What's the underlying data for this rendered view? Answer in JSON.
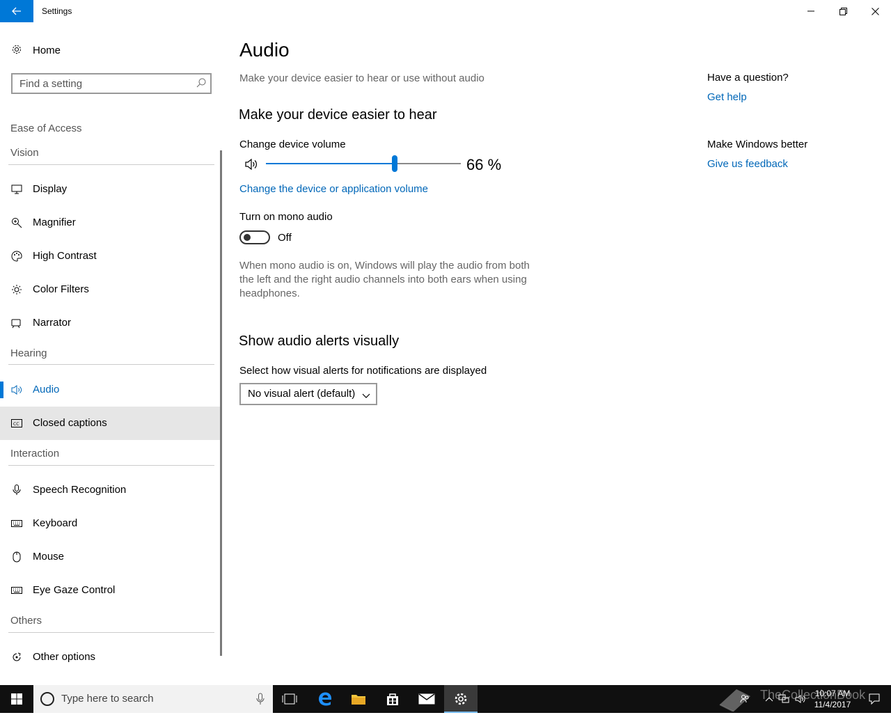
{
  "window": {
    "title": "Settings"
  },
  "sidebar": {
    "home_label": "Home",
    "search_placeholder": "Find a setting",
    "category": "Ease of Access",
    "sections": {
      "vision": "Vision",
      "hearing": "Hearing",
      "interaction": "Interaction",
      "others": "Others"
    },
    "items": {
      "display": "Display",
      "magnifier": "Magnifier",
      "high_contrast": "High Contrast",
      "color_filters": "Color Filters",
      "narrator": "Narrator",
      "audio": "Audio",
      "closed_captions": "Closed captions",
      "speech_recognition": "Speech Recognition",
      "keyboard": "Keyboard",
      "mouse": "Mouse",
      "eye_gaze": "Eye Gaze Control",
      "other_options": "Other options"
    },
    "selected": "audio"
  },
  "main": {
    "title": "Audio",
    "subtitle": "Make your device easier to hear or use without audio",
    "hear_heading": "Make your device easier to hear",
    "volume_label": "Change device volume",
    "volume_value": 66,
    "volume_text": "66 %",
    "volume_link": "Change the device or application volume",
    "mono_label": "Turn on mono audio",
    "mono_state": "Off",
    "mono_description": "When mono audio is on, Windows will play the audio from both the left and the right audio channels into both ears when using headphones.",
    "alerts_heading": "Show audio alerts visually",
    "alerts_label": "Select how visual alerts for notifications are displayed",
    "alerts_value": "No visual alert (default)"
  },
  "right": {
    "question": "Have a question?",
    "help_link": "Get help",
    "better": "Make Windows better",
    "feedback_link": "Give us feedback"
  },
  "taskbar": {
    "search_placeholder": "Type here to search",
    "time": "10:07 AM",
    "date": "11/4/2017",
    "watermark": "TheCollectionBook"
  },
  "colors": {
    "accent": "#0078d7",
    "link": "#0067b8",
    "taskbar": "#101010"
  }
}
